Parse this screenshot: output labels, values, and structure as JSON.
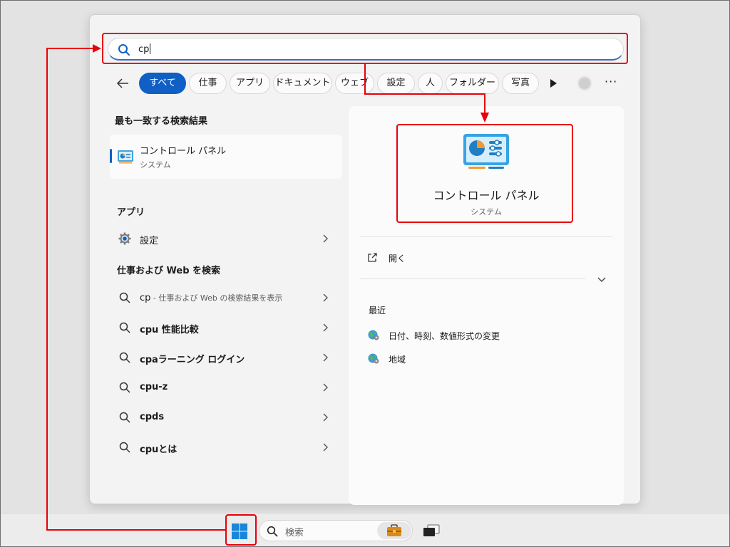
{
  "search": {
    "query": "cp"
  },
  "filters": [
    "すべて",
    "仕事",
    "アプリ",
    "ドキュメント",
    "ウェブ",
    "設定",
    "人",
    "フォルダー",
    "写真"
  ],
  "left": {
    "best_match_header": "最も一致する検索結果",
    "best_match": {
      "title": "コントロール パネル",
      "subtitle": "システム"
    },
    "apps_header": "アプリ",
    "apps": [
      {
        "label": "設定",
        "icon": "gear-icon"
      }
    ],
    "web_header": "仕事および Web を検索",
    "web_results": [
      {
        "bold": "cp",
        "hint": " - 仕事および Web の検索結果を表示"
      },
      {
        "bold": "cpu 性能比較",
        "hint": ""
      },
      {
        "bold": "cpaラーニング ログイン",
        "hint": ""
      },
      {
        "bold": "cpu-z",
        "hint": ""
      },
      {
        "bold": "cpds",
        "hint": ""
      },
      {
        "bold": "cpuとは",
        "hint": ""
      }
    ]
  },
  "preview": {
    "title": "コントロール パネル",
    "subtitle": "システム",
    "open_label": "開く",
    "recent_header": "最近",
    "recent_items": [
      "日付、時刻、数値形式の変更",
      "地域"
    ]
  },
  "taskbar": {
    "search_placeholder": "検索"
  },
  "colors": {
    "accent": "#0f5fc4",
    "annotation": "#e8000b"
  }
}
